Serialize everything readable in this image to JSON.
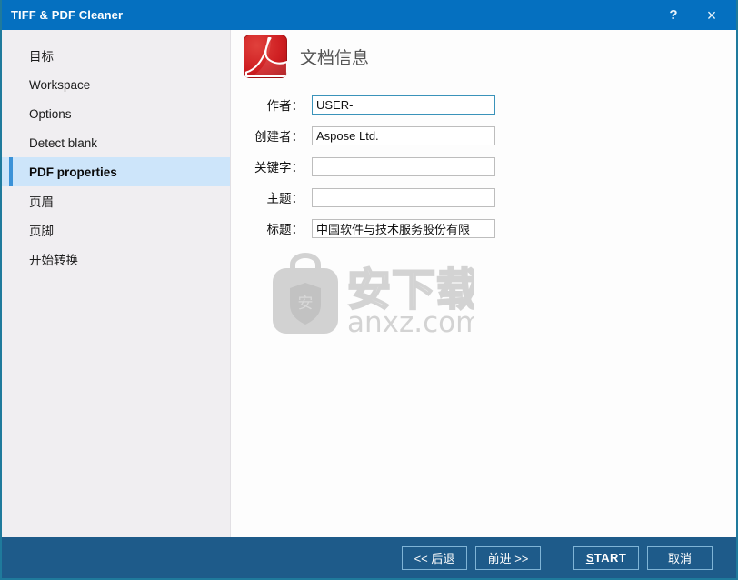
{
  "window": {
    "title": "TIFF & PDF Cleaner",
    "help_icon": "question-mark-icon",
    "close_icon": "close-icon",
    "help_label": "?",
    "close_label": "×",
    "accent_color": "#0570c0",
    "footer_color": "#1e5b8a",
    "border_color": "#1f7a9c"
  },
  "sidebar": {
    "background": "#f0eef1",
    "selected_background": "#cde5fa",
    "selected_accent": "#3b92d8",
    "items": [
      {
        "label": "目标",
        "selected": false
      },
      {
        "label": "Workspace",
        "selected": false
      },
      {
        "label": "Options",
        "selected": false
      },
      {
        "label": "Detect blank",
        "selected": false
      },
      {
        "label": "PDF properties",
        "selected": true
      },
      {
        "label": "页眉",
        "selected": false
      },
      {
        "label": "页脚",
        "selected": false
      },
      {
        "label": "开始转换",
        "selected": false
      }
    ]
  },
  "content": {
    "icon": "pdf-document-icon",
    "title": "文档信息",
    "fields": [
      {
        "label": "作者：",
        "value": "USER-",
        "placeholder": "",
        "focused": true
      },
      {
        "label": "创建者：",
        "value": "Aspose Ltd.",
        "placeholder": "",
        "focused": false
      },
      {
        "label": "关键字：",
        "value": "",
        "placeholder": "",
        "focused": false
      },
      {
        "label": "主题：",
        "value": "",
        "placeholder": "",
        "focused": false
      },
      {
        "label": "标题：",
        "value": "中国软件与技术服务股份有限",
        "placeholder": "",
        "focused": false
      }
    ]
  },
  "watermark": {
    "icon": "shopping-bag-shield-icon",
    "brand_cjk": "安下载",
    "domain": "anxz.com",
    "color": "#d3d3d3"
  },
  "footer": {
    "buttons": [
      {
        "name": "back-button",
        "label": "<< 后退"
      },
      {
        "name": "next-button",
        "label": "前进 >>"
      },
      {
        "name": "start-button",
        "label": "START",
        "accel": "S",
        "rest": "TART"
      },
      {
        "name": "cancel-button",
        "label": "取消"
      }
    ]
  }
}
